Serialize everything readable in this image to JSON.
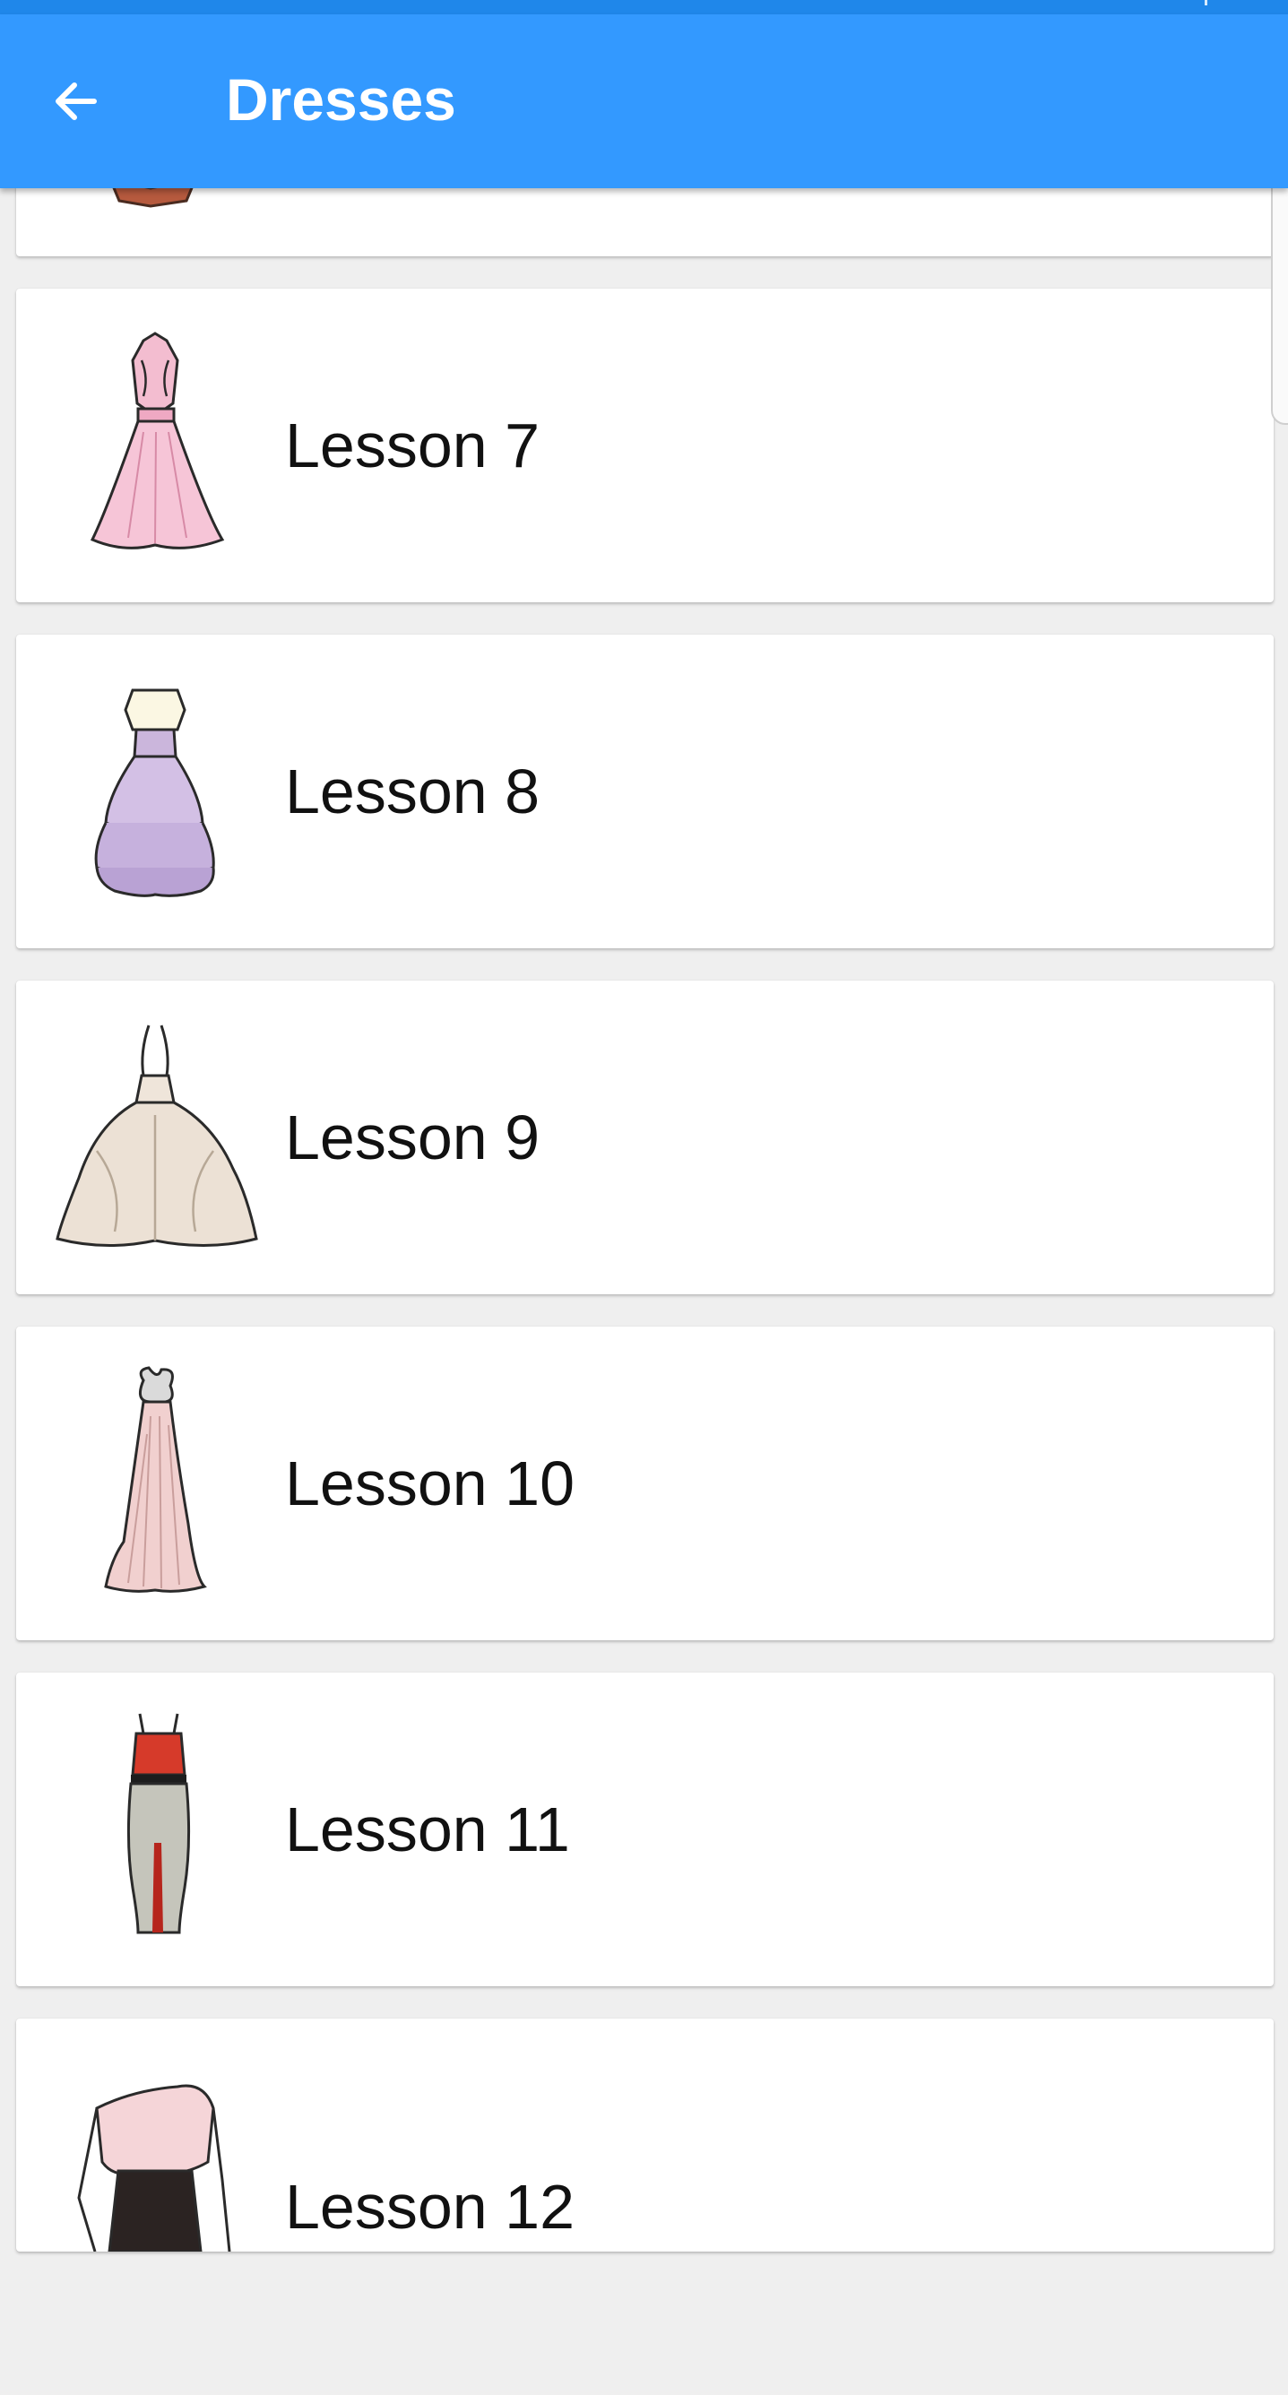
{
  "appbar": {
    "title": "Dresses",
    "back_icon": "arrow-left-icon",
    "background": "#3399ff"
  },
  "lessons": [
    {
      "label": "Lesson 7",
      "icon": "pink-ruffle-dress-icon"
    },
    {
      "label": "Lesson 8",
      "icon": "lavender-tiered-dress-icon"
    },
    {
      "label": "Lesson 9",
      "icon": "cream-ruffle-gown-icon"
    },
    {
      "label": "Lesson 10",
      "icon": "blush-pleated-gown-icon"
    },
    {
      "label": "Lesson 11",
      "icon": "red-top-pencil-skirt-icon"
    },
    {
      "label": "Lesson 12",
      "icon": "offshoulder-blouse-icon"
    }
  ]
}
